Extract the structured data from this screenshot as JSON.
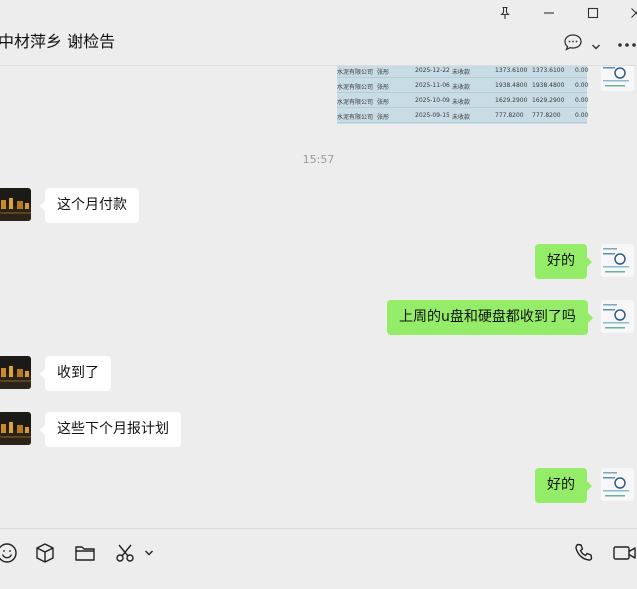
{
  "window": {
    "pin_icon": "pin-icon",
    "minimize_icon": "minimize-icon",
    "maximize_icon": "maximize-icon",
    "close_icon": "close-icon"
  },
  "header": {
    "title": "中材萍乡 谢检告",
    "chat_icon": "chat-bubble-icon",
    "more_icon": "more-icon"
  },
  "spreadsheet_image": {
    "rows": [
      {
        "company": "水泥有限公司",
        "person": "张彤",
        "date": "2025-12-22",
        "status": "未收款",
        "amount1": "1373.6100",
        "amount2": "1373.6100",
        "amount3": "0.00"
      },
      {
        "company": "水泥有限公司",
        "person": "张彤",
        "date": "2025-11-06",
        "status": "未收款",
        "amount1": "1938.4800",
        "amount2": "1938.4800",
        "amount3": "0.00"
      },
      {
        "company": "水泥有限公司",
        "person": "张彤",
        "date": "2025-10-09",
        "status": "未收款",
        "amount1": "1629.2900",
        "amount2": "1629.2900",
        "amount3": "0.00"
      },
      {
        "company": "水泥有限公司",
        "person": "张彤",
        "date": "2025-09-15",
        "status": "未收款",
        "amount1": "777.8200",
        "amount2": "777.8200",
        "amount3": "0.00"
      }
    ]
  },
  "messages": {
    "timestamp": "15:57",
    "items": [
      {
        "from": "other",
        "text": "这个月付款"
      },
      {
        "from": "self",
        "text": "好的"
      },
      {
        "from": "self",
        "text": "上周的u盘和硬盘都收到了吗"
      },
      {
        "from": "other",
        "text": "收到了"
      },
      {
        "from": "other",
        "text": "这些下个月报计划"
      },
      {
        "from": "self",
        "text": "好的"
      }
    ]
  },
  "toolbar": {
    "icons": [
      "emoji-icon",
      "sticker-icon",
      "folder-icon",
      "screenshot-icon",
      "chevron-down-icon",
      "voice-call-icon",
      "video-call-icon"
    ]
  }
}
